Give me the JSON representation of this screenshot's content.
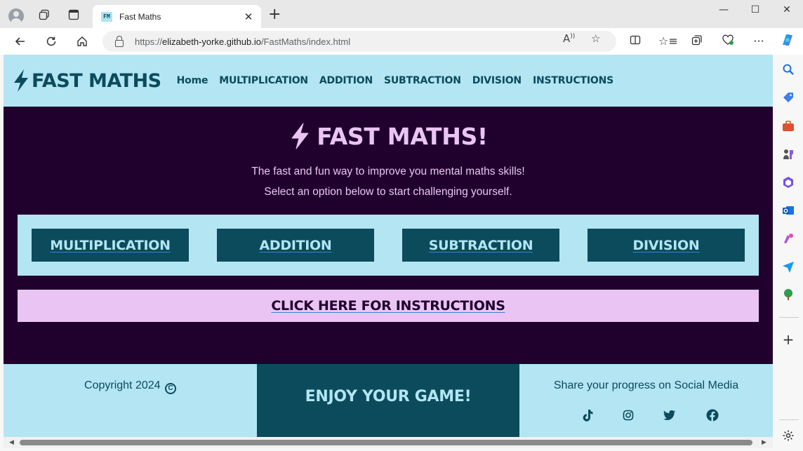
{
  "browser": {
    "tab_title": "Fast Maths",
    "favicon_text": "FM",
    "url_prefix": "https://",
    "url_host": "elizabeth-yorke.github.io",
    "url_path": "/FastMaths/index.html"
  },
  "site": {
    "logo_text": "FAST MATHS",
    "nav": [
      "Home",
      "MULTIPLICATION",
      "ADDITION",
      "SUBTRACTION",
      "DIVISION",
      "INSTRUCTIONS"
    ],
    "hero_title": "FAST MATHS!",
    "hero_line1": "The fast and fun way to improve you mental maths skills!",
    "hero_line2": "Select an option below to start challenging yourself.",
    "options": [
      "MULTIPLICATION",
      "ADDITION",
      "SUBTRACTION",
      "DIVISION"
    ],
    "instructions_link": "CLICK HERE FOR INSTRUCTIONS",
    "copyright": "Copyright 2024",
    "enjoy": "ENJOY YOUR GAME!",
    "share": "Share your progress on Social Media",
    "social_icons": [
      "tiktok-icon",
      "instagram-icon",
      "twitter-icon",
      "facebook-icon"
    ]
  },
  "colors": {
    "light_blue": "#b3e5f3",
    "dark_teal": "#0b4b5c",
    "deep_purple": "#20002c",
    "lilac": "#eac5f4"
  }
}
